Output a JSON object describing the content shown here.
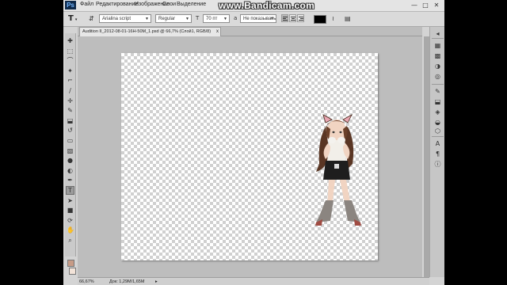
{
  "watermark": "www.Bandicam.com",
  "app": {
    "logo": "Ps",
    "menu": [
      "Файл",
      "Редактирование",
      "Изображение",
      "Слои",
      "Выделение"
    ],
    "window_controls": [
      "—",
      "□",
      "✕"
    ]
  },
  "options": {
    "tool_glyph": "T",
    "font_family": "Arialina script",
    "font_style": "Regular",
    "size_glyph": "T",
    "font_size": "70 пт",
    "aa_glyph": "a",
    "antialias": "Не показывать",
    "text_color": "#000000",
    "warp_glyph": "≀",
    "panels_glyph": "▤"
  },
  "document": {
    "tab_title": "Audition II_2012-08-01-16H-50M_1.psd @ 66,7% (Слой1, RGB/8)",
    "tab_close": "x"
  },
  "tools": [
    {
      "name": "move-tool",
      "glyph": "✚"
    },
    {
      "name": "marquee-tool",
      "glyph": "⬚"
    },
    {
      "name": "lasso-tool",
      "glyph": "⌒"
    },
    {
      "name": "quick-select-tool",
      "glyph": "✦"
    },
    {
      "name": "crop-tool",
      "glyph": "⌐"
    },
    {
      "name": "eyedropper-tool",
      "glyph": "∕"
    },
    {
      "name": "healing-brush-tool",
      "glyph": "✛"
    },
    {
      "name": "brush-tool",
      "glyph": "✎"
    },
    {
      "name": "clone-stamp-tool",
      "glyph": "⬓"
    },
    {
      "name": "history-brush-tool",
      "glyph": "↺"
    },
    {
      "name": "eraser-tool",
      "glyph": "▭"
    },
    {
      "name": "gradient-tool",
      "glyph": "▧"
    },
    {
      "name": "blur-tool",
      "glyph": "●"
    },
    {
      "name": "dodge-tool",
      "glyph": "◐"
    },
    {
      "name": "pen-tool",
      "glyph": "✒"
    },
    {
      "name": "type-tool",
      "glyph": "T"
    },
    {
      "name": "path-select-tool",
      "glyph": "➤"
    },
    {
      "name": "shape-tool",
      "glyph": "■"
    },
    {
      "name": "3d-rotate-tool",
      "glyph": "⟳"
    },
    {
      "name": "hand-tool",
      "glyph": "✋"
    },
    {
      "name": "zoom-tool",
      "glyph": "⌕"
    }
  ],
  "swatches": {
    "foreground": "#c79b86",
    "background": "#f2e3d8"
  },
  "panels": [
    {
      "name": "panel-toggle-icon",
      "glyph": "◂"
    },
    {
      "name": "color-panel-icon",
      "glyph": "▦"
    },
    {
      "name": "swatches-panel-icon",
      "glyph": "▩"
    },
    {
      "name": "adjustments-panel-icon",
      "glyph": "◑"
    },
    {
      "name": "masks-panel-icon",
      "glyph": "◎"
    },
    {
      "name": "brushes-panel-icon",
      "glyph": "✎"
    },
    {
      "name": "clone-source-panel-icon",
      "glyph": "⬓"
    },
    {
      "name": "layers-panel-icon",
      "glyph": "◈"
    },
    {
      "name": "channels-panel-icon",
      "glyph": "◒"
    },
    {
      "name": "paths-panel-icon",
      "glyph": "⬡"
    },
    {
      "name": "character-panel-icon",
      "glyph": "A"
    },
    {
      "name": "paragraph-panel-icon",
      "glyph": "¶"
    },
    {
      "name": "info-panel-icon",
      "glyph": "ⓘ"
    }
  ],
  "status": {
    "zoom": "66,67%",
    "doc_info": "Док: 1,29M/1,65M",
    "arrow": "▸"
  }
}
